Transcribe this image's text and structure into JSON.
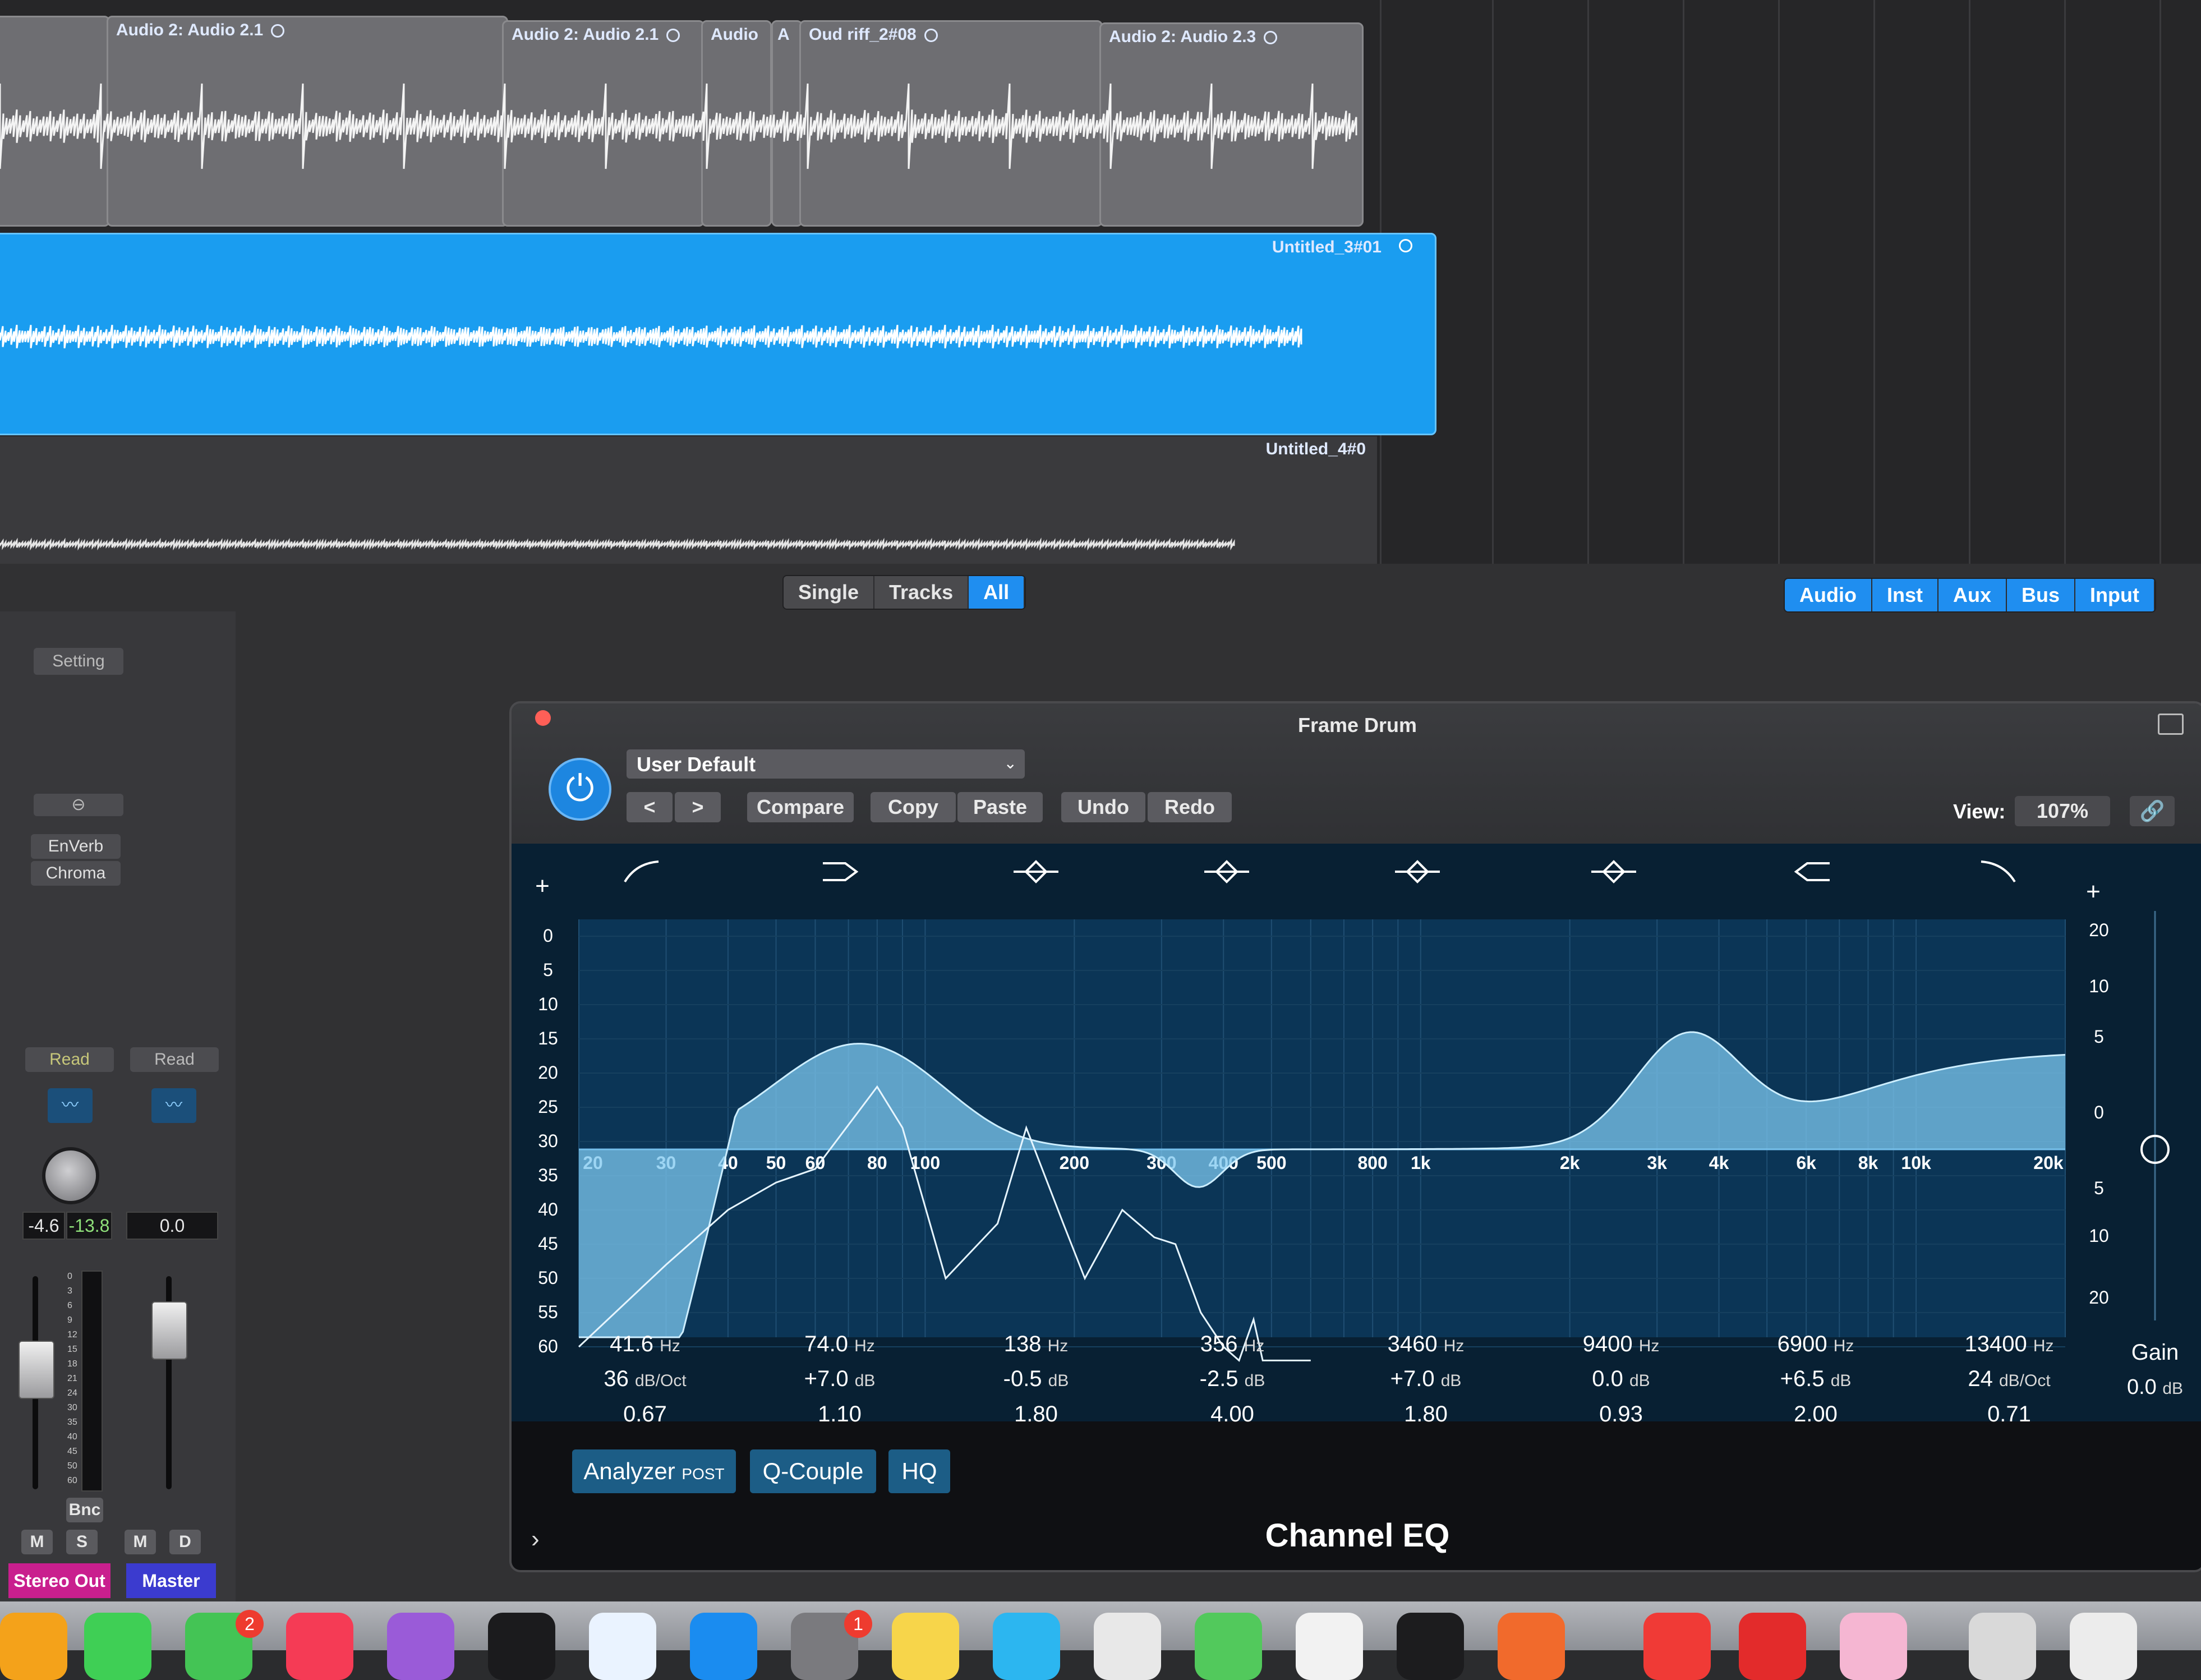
{
  "arrange": {
    "regions_top": [
      {
        "name": "Audio 2: Audio 2.1"
      },
      {
        "name": "Audio 2: Audio 2.1"
      },
      {
        "name": "Audio"
      },
      {
        "name": "A"
      },
      {
        "name": "Oud riff_2#08"
      },
      {
        "name": "Audio 2: Audio 2.3"
      }
    ],
    "region_selected": "Untitled_3#01",
    "region_lower": "Untitled_4#0"
  },
  "mixer": {
    "view_tabs": [
      "Single",
      "Tracks",
      "All"
    ],
    "active_view": "All",
    "filter_tabs": [
      "Audio",
      "Inst",
      "Aux",
      "Bus",
      "Input"
    ],
    "strips": {
      "setting": "Setting",
      "plugins": [
        "EnVerb",
        "Chroma"
      ],
      "automation_left": "Read",
      "automation_right": "Read",
      "level_left": "-4.6",
      "peak_left": "-13.8",
      "level_right": "0.0",
      "bnc": "Bnc",
      "mute": "M",
      "solo": "S",
      "dim": "D",
      "name_left": "Stereo Out",
      "name_right": "Master",
      "meter_scale": [
        "0",
        "3",
        "6",
        "9",
        "12",
        "15",
        "18",
        "21",
        "24",
        "30",
        "35",
        "40",
        "45",
        "50",
        "60"
      ]
    }
  },
  "eq": {
    "title": "Frame Drum",
    "preset": "User Default",
    "buttons": {
      "prev": "<",
      "next": ">",
      "compare": "Compare",
      "copy": "Copy",
      "paste": "Paste",
      "undo": "Undo",
      "redo": "Redo"
    },
    "view_label": "View:",
    "view_value": "107%",
    "analyzer_scale": [
      "0",
      "5",
      "10",
      "15",
      "20",
      "25",
      "30",
      "35",
      "40",
      "45",
      "50",
      "55",
      "60"
    ],
    "gain_scale": [
      "20",
      "10",
      "5",
      "0",
      "5",
      "10",
      "20"
    ],
    "freq_labels": [
      "20",
      "30",
      "40",
      "50",
      "60",
      "80",
      "100",
      "200",
      "300",
      "400",
      "500",
      "800",
      "1k",
      "2k",
      "3k",
      "4k",
      "6k",
      "8k",
      "10k",
      "20k"
    ],
    "bands": [
      {
        "freq": "41.6",
        "unit": "Hz",
        "gain": "36",
        "gain_unit": "dB/Oct",
        "q": "0.67"
      },
      {
        "freq": "74.0",
        "unit": "Hz",
        "gain": "+7.0",
        "gain_unit": "dB",
        "q": "1.10"
      },
      {
        "freq": "138",
        "unit": "Hz",
        "gain": "-0.5",
        "gain_unit": "dB",
        "q": "1.80"
      },
      {
        "freq": "356",
        "unit": "Hz",
        "gain": "-2.5",
        "gain_unit": "dB",
        "q": "4.00"
      },
      {
        "freq": "3460",
        "unit": "Hz",
        "gain": "+7.0",
        "gain_unit": "dB",
        "q": "1.80"
      },
      {
        "freq": "9400",
        "unit": "Hz",
        "gain": "0.0",
        "gain_unit": "dB",
        "q": "0.93"
      },
      {
        "freq": "6900",
        "unit": "Hz",
        "gain": "+6.5",
        "gain_unit": "dB",
        "q": "2.00"
      },
      {
        "freq": "13400",
        "unit": "Hz",
        "gain": "24",
        "gain_unit": "dB/Oct",
        "q": "0.71"
      }
    ],
    "master_gain_label": "Gain",
    "master_gain_value": "0.0",
    "master_gain_unit": "dB",
    "analyzer": "Analyzer",
    "analyzer_mode": "POST",
    "q_couple": "Q-Couple",
    "hq": "HQ",
    "plugin_name": "Channel EQ"
  },
  "dock": {
    "badge_1": "2",
    "badge_2": "1"
  }
}
